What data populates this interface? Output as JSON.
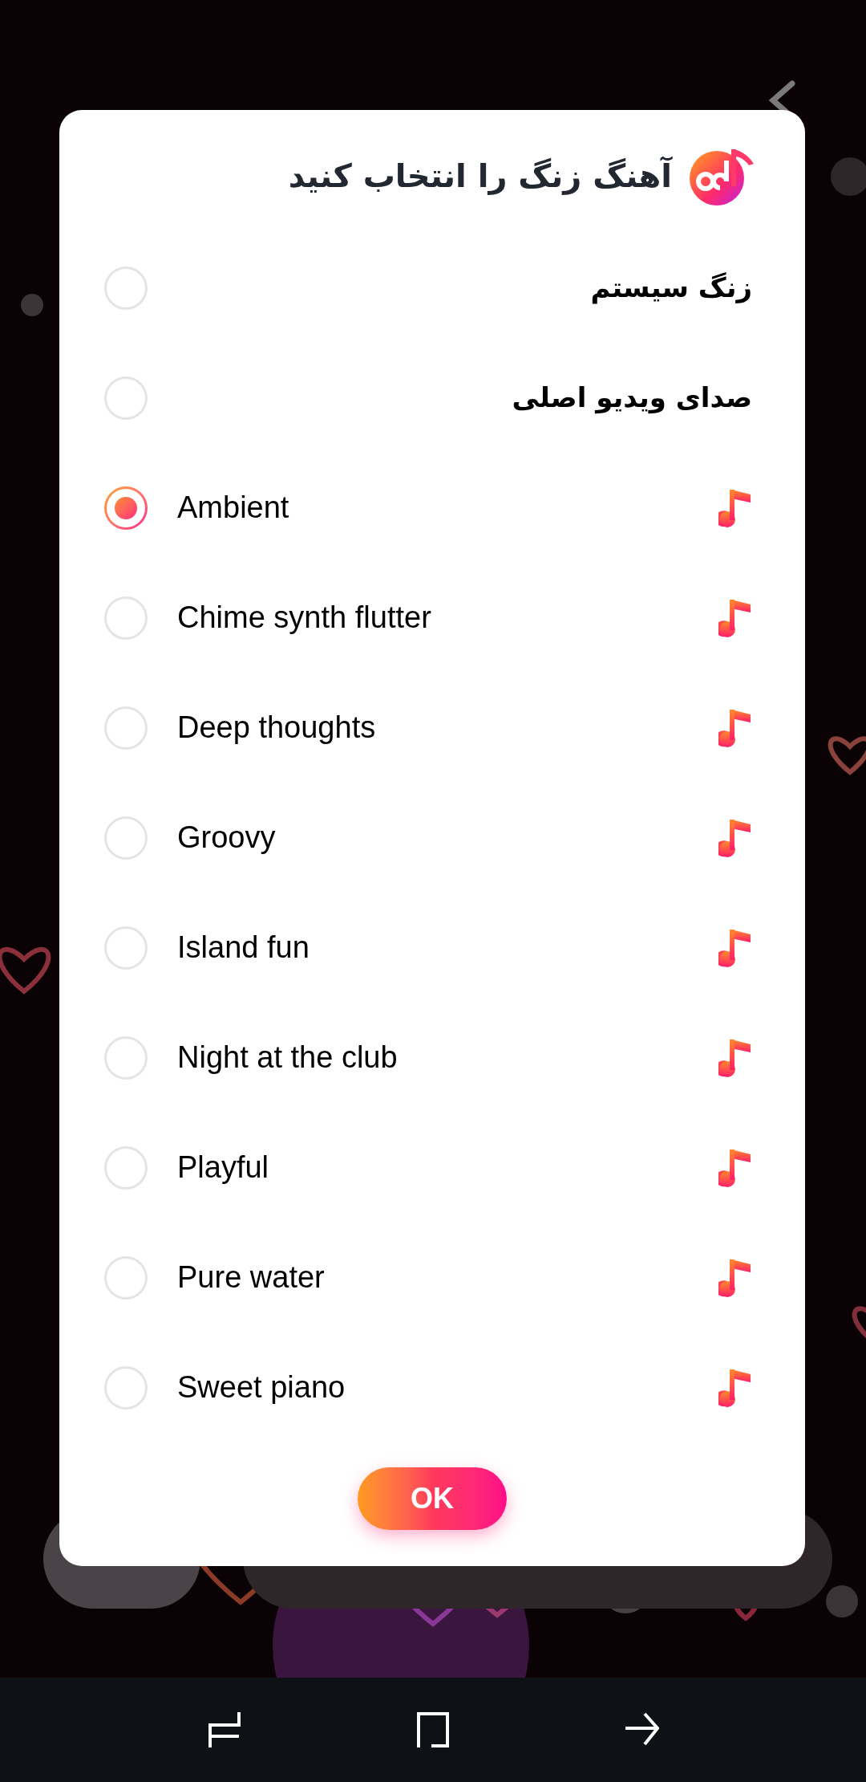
{
  "dialog": {
    "title": "آهنگ زنگ را انتخاب کنید",
    "options": [
      {
        "kind": "system",
        "label": "زنگ سیستم",
        "selected": false
      },
      {
        "kind": "system",
        "label": "صدای ویدیو اصلی",
        "selected": false
      },
      {
        "kind": "tone",
        "label": "Ambient",
        "selected": true
      },
      {
        "kind": "tone",
        "label": "Chime synth flutter",
        "selected": false
      },
      {
        "kind": "tone",
        "label": "Deep thoughts",
        "selected": false
      },
      {
        "kind": "tone",
        "label": "Groovy",
        "selected": false
      },
      {
        "kind": "tone",
        "label": "Island fun",
        "selected": false
      },
      {
        "kind": "tone",
        "label": "Night at the club",
        "selected": false
      },
      {
        "kind": "tone",
        "label": "Playful",
        "selected": false
      },
      {
        "kind": "tone",
        "label": "Pure water",
        "selected": false
      },
      {
        "kind": "tone",
        "label": "Sweet piano",
        "selected": false
      }
    ],
    "ok_button": "OK"
  }
}
